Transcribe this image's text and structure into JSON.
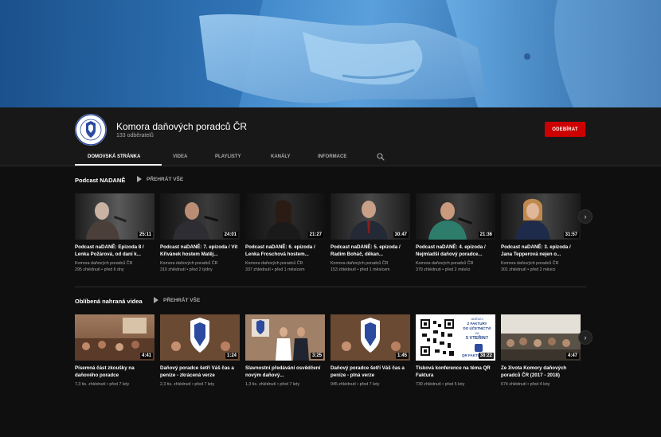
{
  "channel": {
    "name": "Komora daňových poradců ČR",
    "subscribers": "133 odběratelů",
    "subscribe_label": "ODEBÍRAT"
  },
  "tabs": [
    "DOMOVSKÁ STRÁNKA",
    "VIDEA",
    "PLAYLISTY",
    "KANÁLY",
    "INFORMACE"
  ],
  "sections": [
    {
      "title": "Podcast NADANĚ",
      "play_all": "PŘEHRÁT VŠE",
      "videos": [
        {
          "title": "Podcast naDANĚ: Epizoda 8 / Lenka Požárová, od daní k...",
          "channel": "Komora daňových poradců ČR",
          "stats": "295 zhlédnutí • před 6 dny",
          "duration": "25:11"
        },
        {
          "title": "Podcast naDANĚ: 7. epizoda / Vít Křivánek hostem Matěj...",
          "channel": "Komora daňových poradců ČR",
          "stats": "310 zhlédnutí • před 2 týdny",
          "duration": "24:01"
        },
        {
          "title": "Podcast naDANĚ: 6. epizoda / Lenka Froschová hostem...",
          "channel": "Komora daňových poradců ČR",
          "stats": "337 zhlédnutí • před 1 měsícem",
          "duration": "21:27"
        },
        {
          "title": "Podcast naDANĚ: 5. epizoda / Radim Boháč, děkan...",
          "channel": "Komora daňových poradců ČR",
          "stats": "153 zhlédnutí • před 1 měsícem",
          "duration": "30:47"
        },
        {
          "title": "Podcast naDANĚ: 4. epizoda / Nejmladší daňový poradce...",
          "channel": "Komora daňových poradců ČR",
          "stats": "379 zhlédnutí • před 2 měsíci",
          "duration": "21:36"
        },
        {
          "title": "Podcast naDANĚ: 3. epizoda / Jana Tepperová nejen o...",
          "channel": "Komora daňových poradců ČR",
          "stats": "301 zhlédnutí • před 2 měsíci",
          "duration": "31:57"
        }
      ]
    },
    {
      "title": "Oblíbená nahraná videa",
      "play_all": "PŘEHRÁT VŠE",
      "videos": [
        {
          "title": "Písemná část zkoušky na daňového poradce",
          "stats": "7,3 tis. zhlédnutí • před 7 lety",
          "duration": "4:41"
        },
        {
          "title": "Daňový poradce šetří Váš čas a peníze - zkrácená verze",
          "stats": "2,3 tis. zhlédnutí • před 7 lety",
          "duration": "1:24"
        },
        {
          "title": "Slavnostní předávání osvědčení novým daňový...",
          "stats": "1,3 tis. zhlédnutí • před 7 lety",
          "duration": "3:25"
        },
        {
          "title": "Daňový poradce šetří Váš čas a peníze - plná verze",
          "stats": "945 zhlédnutí • před 7 lety",
          "duration": "1:45"
        },
        {
          "title": "Tisková konference na téma QR Faktura",
          "stats": "739 zhlédnutí • před 5 lety",
          "duration": "38:22"
        },
        {
          "title": "Ze života Komory daňových poradců ČR (2017 - 2018)",
          "stats": "674 zhlédnutí • před 4 lety",
          "duration": "4:47"
        }
      ]
    }
  ],
  "qr_thumb": {
    "line1": "UDĚLEJ",
    "line2": "Z FAKTURY",
    "line3": "DO ÚČETNICTVÍ",
    "line4": "ZA",
    "line5": "5 VTEŘIN?",
    "brand": "QR FAKTURA"
  },
  "logo_text": "KOMORA DAŇOVÝCH PORADCŮ ČR",
  "colors": {
    "accent": "#cc0000",
    "background": "#0f0f0f",
    "header": "#181818"
  }
}
